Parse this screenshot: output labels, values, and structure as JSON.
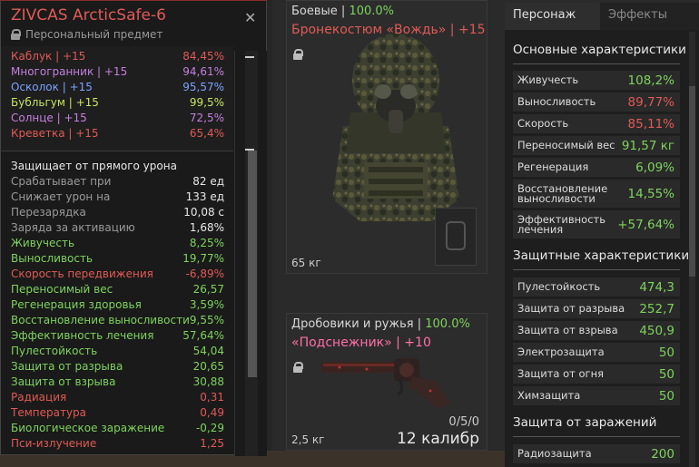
{
  "colors": {
    "green": "#7ed35d",
    "red": "#e05a55",
    "pink": "#ff6fa4",
    "purple": "#c57fe0",
    "blue": "#7aa2ff",
    "yellow_green": "#c9e35d"
  },
  "tooltip": {
    "title": "ZIVCAS ArcticSafe-6",
    "close": "✕",
    "subtitle": "Персональный предмет",
    "artifacts": [
      {
        "name": "Каблук | +15",
        "value": "84,45%",
        "color": "#e05a55"
      },
      {
        "name": "Многогранник | +15",
        "value": "94,61%",
        "color": "#c57fe0"
      },
      {
        "name": "Осколок | +15",
        "value": "95,57%",
        "color": "#7aa2ff"
      },
      {
        "name": "Бубльгум | +15",
        "value": "99,5%",
        "color": "#c9e35d"
      },
      {
        "name": "Солнце | +15",
        "value": "72,5%",
        "color": "#c57fe0"
      },
      {
        "name": "Креветка | +15",
        "value": "65,4%",
        "color": "#e05a55"
      }
    ],
    "section_title": "Защищает от прямого урона",
    "stats": [
      {
        "name": "Срабатывает при",
        "value": "82 ед",
        "ncolor": "#9a9a9a",
        "vcolor": "#e8e8e8"
      },
      {
        "name": "Снижает урон на",
        "value": "133 ед",
        "ncolor": "#9a9a9a",
        "vcolor": "#e8e8e8"
      },
      {
        "name": "Перезарядка",
        "value": "10,08 с",
        "ncolor": "#9a9a9a",
        "vcolor": "#e8e8e8"
      },
      {
        "name": "Заряда за активацию",
        "value": "1,68%",
        "ncolor": "#9a9a9a",
        "vcolor": "#e8e8e8"
      },
      {
        "name": "Живучесть",
        "value": "8,25%",
        "ncolor": "#7ed35d",
        "vcolor": "#7ed35d"
      },
      {
        "name": "Выносливость",
        "value": "19,77%",
        "ncolor": "#7ed35d",
        "vcolor": "#7ed35d"
      },
      {
        "name": "Скорость передвижения",
        "value": "-6,89%",
        "ncolor": "#e05a55",
        "vcolor": "#e05a55"
      },
      {
        "name": "Переносимый вес",
        "value": "26,57",
        "ncolor": "#7ed35d",
        "vcolor": "#7ed35d"
      },
      {
        "name": "Регенерация здоровья",
        "value": "3,59%",
        "ncolor": "#7ed35d",
        "vcolor": "#7ed35d"
      },
      {
        "name": "Восстановление выносливости",
        "value": "9,55%",
        "ncolor": "#7ed35d",
        "vcolor": "#7ed35d"
      },
      {
        "name": "Эффективность лечения",
        "value": "57,64%",
        "ncolor": "#7ed35d",
        "vcolor": "#7ed35d"
      },
      {
        "name": "Пулестойкость",
        "value": "54,04",
        "ncolor": "#7ed35d",
        "vcolor": "#7ed35d"
      },
      {
        "name": "Защита от разрыва",
        "value": "20,65",
        "ncolor": "#7ed35d",
        "vcolor": "#7ed35d"
      },
      {
        "name": "Защита от взрыва",
        "value": "30,88",
        "ncolor": "#7ed35d",
        "vcolor": "#7ed35d"
      },
      {
        "name": "Радиация",
        "value": "0,31",
        "ncolor": "#e05a55",
        "vcolor": "#e05a55"
      },
      {
        "name": "Температура",
        "value": "0,49",
        "ncolor": "#e05a55",
        "vcolor": "#e05a55"
      },
      {
        "name": "Биологическое заражение",
        "value": "-0,29",
        "ncolor": "#7ed35d",
        "vcolor": "#7ed35d"
      },
      {
        "name": "Пси-излучение",
        "value": "1,25",
        "ncolor": "#e05a55",
        "vcolor": "#e05a55"
      }
    ]
  },
  "armor_card": {
    "category": "Боевые | ",
    "condition": "100.0%",
    "name": "Бронекостюм «Вождь» | +15",
    "name_color": "#e05a55",
    "weight": "65 кг"
  },
  "weapon_card": {
    "category": "Дробовики и ружья | ",
    "condition": "100.0%",
    "name": "«Подснежник» | +10",
    "name_color": "#ff6fa4",
    "weight": "2,5 кг",
    "ammo": "0/5/0",
    "caliber": "12 калибр"
  },
  "character": {
    "tabs": [
      "Персонаж",
      "Эффекты"
    ],
    "sections": [
      {
        "title": "Основные характеристики",
        "rows": [
          {
            "name": "Живучесть",
            "value": "108,2%",
            "color": "#7ed35d"
          },
          {
            "name": "Выносливость",
            "value": "89,77%",
            "color": "#e05a55"
          },
          {
            "name": "Скорость",
            "value": "85,11%",
            "color": "#e05a55"
          },
          {
            "name": "Переносимый вес",
            "value": "91,57 кг",
            "color": "#7ed35d"
          },
          {
            "name": "Регенерация",
            "value": "6,09%",
            "color": "#7ed35d"
          },
          {
            "name": "Восстановление выносливости",
            "value": "14,55%",
            "color": "#7ed35d"
          },
          {
            "name": "Эффективность лечения",
            "value": "+57,64%",
            "color": "#7ed35d"
          }
        ]
      },
      {
        "title": "Защитные характеристики",
        "rows": [
          {
            "name": "Пулестойкость",
            "value": "474,3",
            "color": "#7ed35d"
          },
          {
            "name": "Защита от разрыва",
            "value": "252,7",
            "color": "#7ed35d"
          },
          {
            "name": "Защита от взрыва",
            "value": "450,9",
            "color": "#7ed35d"
          },
          {
            "name": "Электрозащита",
            "value": "50",
            "color": "#7ed35d"
          },
          {
            "name": "Защита от огня",
            "value": "50",
            "color": "#7ed35d"
          },
          {
            "name": "Химзащита",
            "value": "50",
            "color": "#7ed35d"
          }
        ]
      },
      {
        "title": "Защита от заражений",
        "rows": [
          {
            "name": "Радиозащита",
            "value": "200",
            "color": "#7ed35d"
          }
        ]
      }
    ]
  }
}
